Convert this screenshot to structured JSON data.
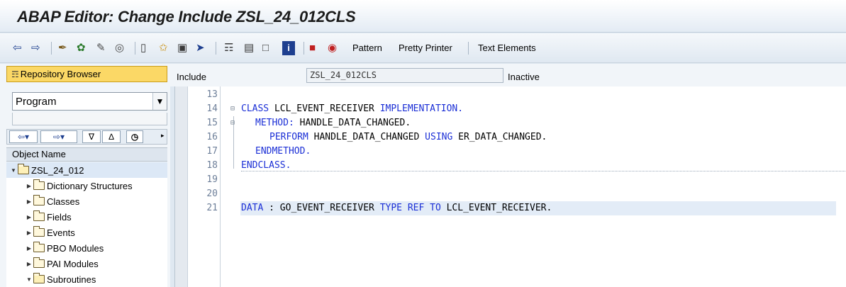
{
  "window": {
    "title": "ABAP Editor: Change Include ZSL_24_012CLS"
  },
  "toolbar": {
    "pattern_label": "Pattern",
    "pretty_printer_label": "Pretty Printer",
    "text_elements_label": "Text Elements"
  },
  "left": {
    "repository_browser_label": "Repository Browser",
    "object_type_selected": "Program",
    "object_name_header": "Object Name",
    "tree": {
      "root": "ZSL_24_012",
      "items": [
        "Dictionary Structures",
        "Classes",
        "Fields",
        "Events",
        "PBO Modules",
        "PAI Modules",
        "Subroutines"
      ]
    }
  },
  "include": {
    "label": "Include",
    "name": "ZSL_24_012CLS",
    "status": "Inactive"
  },
  "editor": {
    "line_numbers": [
      "13",
      "14",
      "15",
      "16",
      "17",
      "18",
      "19",
      "20",
      "21"
    ],
    "code": {
      "l14_kw1": "CLASS",
      "l14_name": " LCL_EVENT_RECEIVER ",
      "l14_kw2": "IMPLEMENTATION.",
      "l15_kw1": "METHOD:",
      "l15_rest": " HANDLE_DATA_CHANGED.",
      "l16_kw1": "PERFORM",
      "l16_mid": " HANDLE_DATA_CHANGED ",
      "l16_kw2": "USING",
      "l16_rest": " ER_DATA_CHANGED.",
      "l17_kw1": "ENDMETHOD.",
      "l18_kw1": "ENDCLASS.",
      "l21_kw1": "DATA",
      "l21_mid": " : GO_EVENT_RECEIVER ",
      "l21_kw2": "TYPE REF TO",
      "l21_rest": " LCL_EVENT_RECEIVER."
    }
  }
}
